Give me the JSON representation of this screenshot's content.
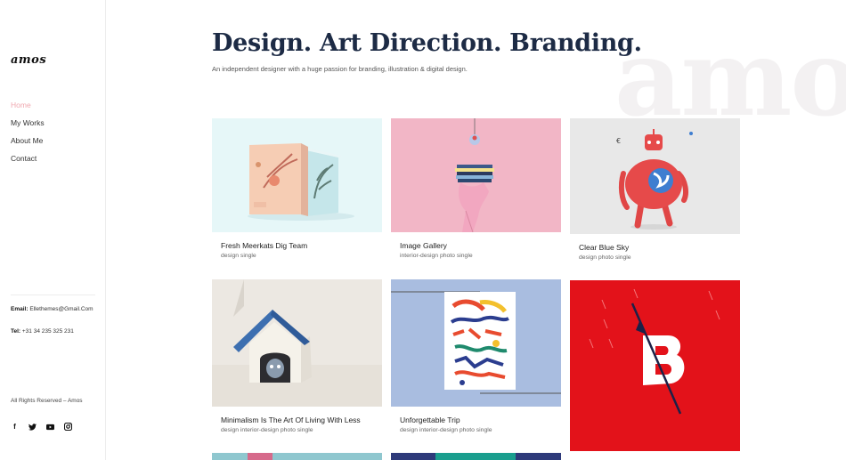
{
  "brand": {
    "logo": "amos",
    "watermark": "amo"
  },
  "nav": [
    {
      "label": "Home",
      "active": true
    },
    {
      "label": "My Works",
      "active": false
    },
    {
      "label": "About Me",
      "active": false
    },
    {
      "label": "Contact",
      "active": false
    }
  ],
  "contact": {
    "email_label": "Email:",
    "email_value": "Ellethemes@Gmail.Com",
    "tel_label": "Tel:",
    "tel_value": "+31 34 235 325 231"
  },
  "footer": {
    "rights": "All Rights Reserved – Amos"
  },
  "socials": [
    {
      "icon": "facebook-icon",
      "glyph": "f"
    },
    {
      "icon": "twitter-icon",
      "glyph": "t"
    },
    {
      "icon": "youtube-icon",
      "glyph": "▶"
    },
    {
      "icon": "instagram-icon",
      "glyph": "◘"
    }
  ],
  "header": {
    "title": "Design. Art Direction. Branding.",
    "subtitle": "An independent designer with a huge passion for branding, illustration & digital design."
  },
  "works": [
    {
      "title": "Fresh Meerkats Dig Team",
      "categories": "design single"
    },
    {
      "title": "Image Gallery",
      "categories": "interior-design photo single"
    },
    {
      "title": "Clear Blue Sky",
      "categories": "design photo single"
    },
    {
      "title": "Minimalism Is The Art Of Living With Less",
      "categories": "design interior-design photo single"
    },
    {
      "title": "Unforgettable Trip",
      "categories": "design interior-design photo single"
    },
    {
      "title": "",
      "categories": ""
    }
  ],
  "colors": {
    "accent": "#f0a8b0",
    "headline": "#1d2b45",
    "card_bg_1": "#e6f7f8",
    "card_bg_2": "#f2b6c6",
    "card_bg_3": "#e8e8e8",
    "card_bg_4": "#ece8e2",
    "card_bg_5": "#a9bde0",
    "card_bg_6": "#e3121a"
  }
}
